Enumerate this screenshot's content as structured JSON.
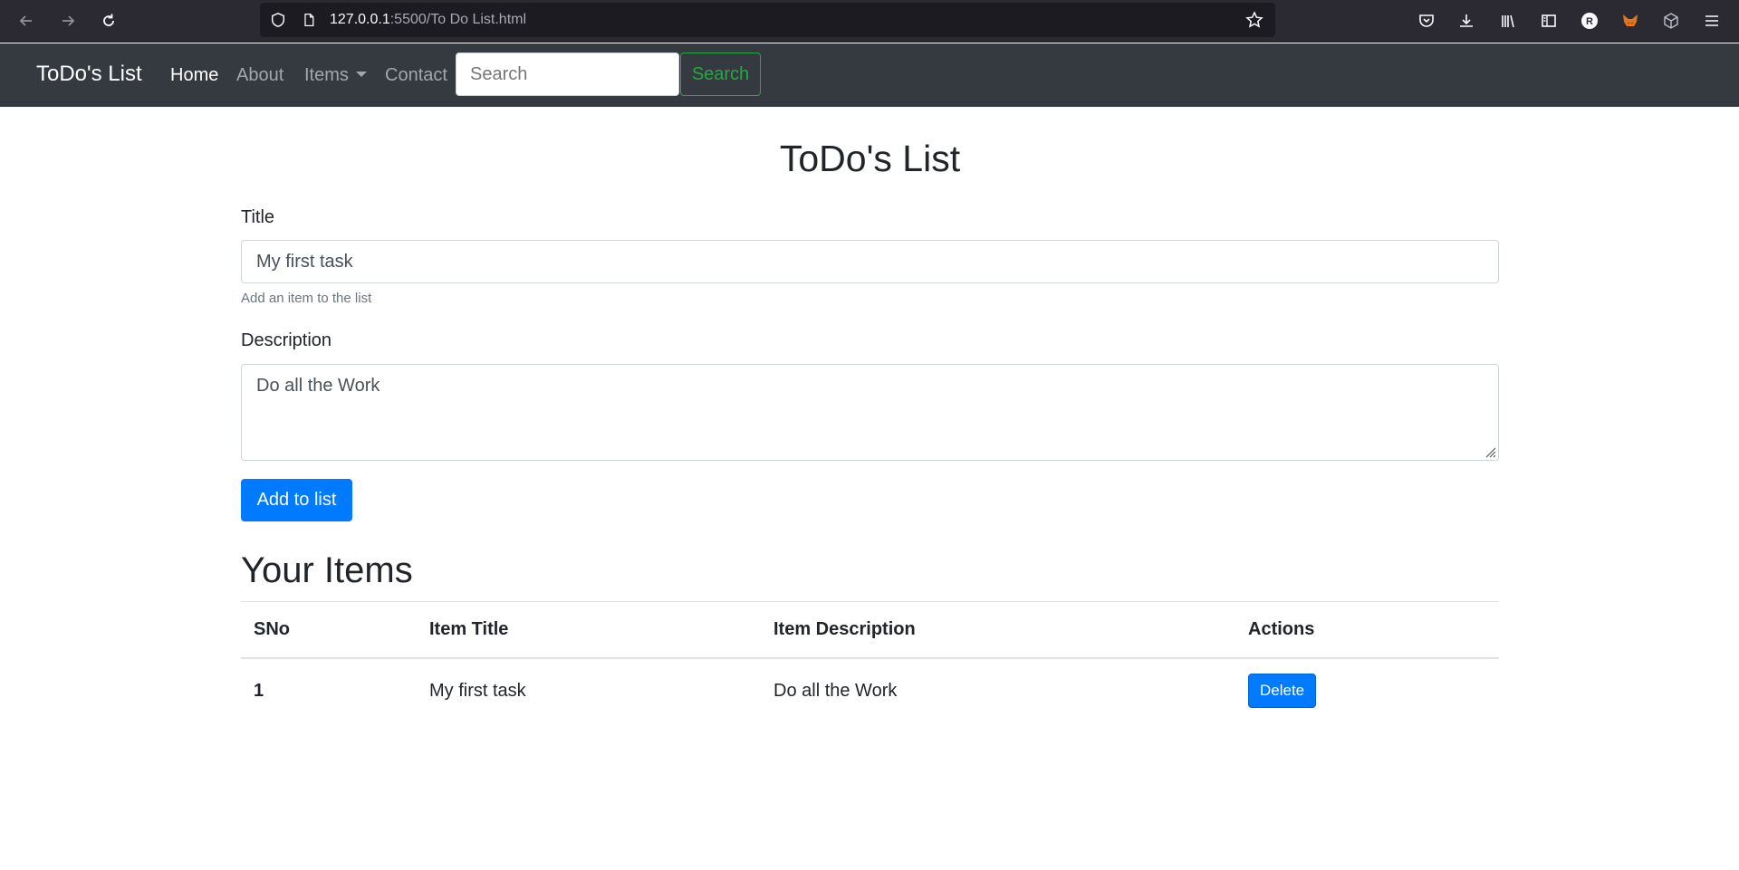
{
  "browser": {
    "url_host": "127.0.0.1",
    "url_rest": ":5500/To Do List.html"
  },
  "navbar": {
    "brand": "ToDo's List",
    "links": [
      "Home",
      "About",
      "Items",
      "Contact"
    ],
    "search_placeholder": "Search",
    "search_button": "Search"
  },
  "main": {
    "title": "ToDo's List",
    "title_label": "Title",
    "title_value": "My first task",
    "title_help": "Add an item to the list",
    "description_label": "Description",
    "description_value": "Do all the Work",
    "add_button": "Add to list",
    "items_heading": "Your Items"
  },
  "table": {
    "headers": [
      "SNo",
      "Item Title",
      "Item Description",
      "Actions"
    ],
    "rows": [
      {
        "sno": "1",
        "title": "My first task",
        "description": "Do all the Work",
        "action": "Delete"
      }
    ]
  },
  "colors": {
    "navbar_bg": "#343a40",
    "primary": "#007bff",
    "success": "#28a745"
  }
}
